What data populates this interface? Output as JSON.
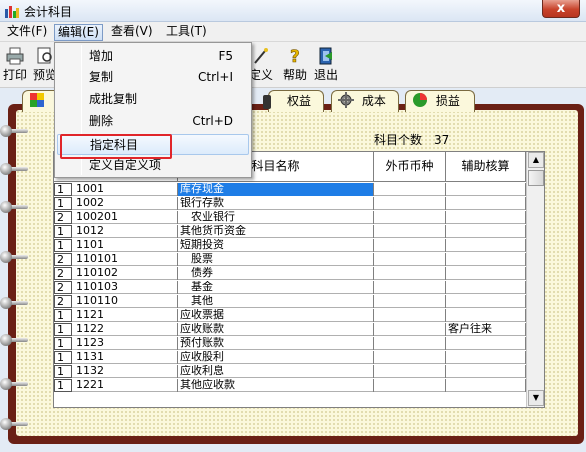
{
  "window": {
    "title": "会计科目",
    "close_label": "x"
  },
  "menubar": {
    "items": [
      "文件(F)",
      "编辑(E)",
      "查看(V)",
      "工具(T)"
    ]
  },
  "toolbar": {
    "buttons": [
      {
        "label": "打印",
        "icon": "printer-icon"
      },
      {
        "label": "预览",
        "icon": "preview-icon"
      },
      {
        "label": "定义",
        "icon": "define-wand-icon"
      },
      {
        "label": "帮助",
        "icon": "help-icon"
      },
      {
        "label": "退出",
        "icon": "exit-icon"
      }
    ]
  },
  "edit_menu": {
    "items": [
      {
        "label": "增加",
        "shortcut": "F5"
      },
      {
        "label": "复制",
        "shortcut": "Ctrl+I"
      },
      {
        "label": "成批复制",
        "shortcut": ""
      },
      {
        "label": "删除",
        "shortcut": "Ctrl+D"
      },
      {
        "label": "指定科目",
        "shortcut": ""
      },
      {
        "label": "定义自定义项",
        "shortcut": ""
      }
    ]
  },
  "tabs": [
    {
      "label": "",
      "icon": "puzzle-icon"
    },
    {
      "label": "权益",
      "icon": ""
    },
    {
      "label": "成本",
      "icon": "gear-icon"
    },
    {
      "label": "损益",
      "icon": "pie-chart-icon"
    }
  ],
  "summary": {
    "count_label": "科目个数",
    "count_value": "37"
  },
  "table": {
    "headers": [
      "科目名称",
      "外币币种",
      "辅助核算"
    ],
    "rows": [
      {
        "level": "1",
        "code": "1001",
        "name": "库存现金",
        "currency": "",
        "aux": "",
        "selected": true
      },
      {
        "level": "1",
        "code": "1002",
        "name": "银行存款",
        "currency": "",
        "aux": ""
      },
      {
        "level": "2",
        "code": "100201",
        "name": "　农业银行",
        "currency": "",
        "aux": ""
      },
      {
        "level": "1",
        "code": "1012",
        "name": "其他货币资金",
        "currency": "",
        "aux": ""
      },
      {
        "level": "1",
        "code": "1101",
        "name": "短期投资",
        "currency": "",
        "aux": ""
      },
      {
        "level": "2",
        "code": "110101",
        "name": "　股票",
        "currency": "",
        "aux": ""
      },
      {
        "level": "2",
        "code": "110102",
        "name": "　债券",
        "currency": "",
        "aux": ""
      },
      {
        "level": "2",
        "code": "110103",
        "name": "　基金",
        "currency": "",
        "aux": ""
      },
      {
        "level": "2",
        "code": "110110",
        "name": "　其他",
        "currency": "",
        "aux": ""
      },
      {
        "level": "1",
        "code": "1121",
        "name": "应收票据",
        "currency": "",
        "aux": ""
      },
      {
        "level": "1",
        "code": "1122",
        "name": "应收账款",
        "currency": "",
        "aux": "客户往来"
      },
      {
        "level": "1",
        "code": "1123",
        "name": "预付账款",
        "currency": "",
        "aux": ""
      },
      {
        "level": "1",
        "code": "1131",
        "name": "应收股利",
        "currency": "",
        "aux": ""
      },
      {
        "level": "1",
        "code": "1132",
        "name": "应收利息",
        "currency": "",
        "aux": ""
      },
      {
        "level": "1",
        "code": "1221",
        "name": "其他应收款",
        "currency": "",
        "aux": ""
      }
    ]
  },
  "colors": {
    "selection": "#1e7de6",
    "highlight_box": "#e0252a",
    "binder": "#6a2015"
  }
}
